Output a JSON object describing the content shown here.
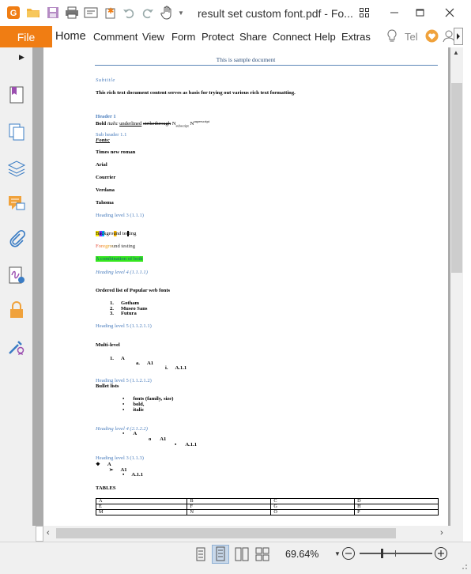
{
  "titlebar": {
    "title": "result set custom font.pdf - Fo...",
    "quick_access": [
      "app-logo-icon",
      "open-folder-icon",
      "save-icon",
      "print-icon",
      "scan-icon",
      "new-icon",
      "undo-icon",
      "redo-icon",
      "hand-tool-icon",
      "dropdown-icon"
    ],
    "window_controls": [
      "grid-icon",
      "minimize-icon",
      "restore-icon",
      "close-icon"
    ]
  },
  "menubar": {
    "file": "File",
    "items": [
      "Home",
      "Comment",
      "View",
      "Form",
      "Protect",
      "Share",
      "Connect",
      "Help",
      "Extras"
    ],
    "tell_me": "Tel",
    "accent_color": "#f07d13"
  },
  "sidebar": {
    "icons": [
      "bookmark-icon",
      "pages-icon",
      "layers-icon",
      "comments-icon",
      "attachments-icon",
      "signature-icon",
      "security-icon",
      "certificate-icon"
    ]
  },
  "document": {
    "header_title": "This is sample document",
    "subtitle": "Subtitle",
    "intro": "This rich text document content serves as basis for trying out various rich text formatting.",
    "header1": "Header 1",
    "fmt_bold": "Bold",
    "fmt_italic": "italic",
    "fmt_underlined": "underlined",
    "fmt_strike": "strikethrough",
    "fmt_n": "N",
    "fmt_sub": "subscript",
    "fmt_n2": "N",
    "fmt_sup": "superscript",
    "subheader": "Sub header 1.1",
    "fonts_label": "Fonts:",
    "fonts": [
      "Times new roman",
      "Arial",
      "Courrier",
      "Verdana",
      "Tahoma"
    ],
    "heading_3a": "Heading level 3 (1.1.1)",
    "background_testing": "Background testing",
    "foreground_testing": "Foreground testing",
    "combination": "A combination of both",
    "heading_4a": "Heading level 4 (1.1.1.1)",
    "ordered_title": "Ordered list of Popular web fonts",
    "ordered_items": [
      {
        "num": "1.",
        "text": "Gotham"
      },
      {
        "num": "2.",
        "text": "Museo Sans"
      },
      {
        "num": "3.",
        "text": "Futura"
      }
    ],
    "heading_5a": "Heading level 5 (1.1.2.1.1)",
    "multilevel_title": "Multi-level",
    "multilevel": [
      {
        "marker": "1.",
        "text": "A"
      },
      {
        "marker": "a.",
        "text": "A1"
      },
      {
        "marker": "i.",
        "text": "A.1.1"
      }
    ],
    "heading_5b": "Heading level 5 (1.1.2.1.2)",
    "bullet_title": "Bullet lists",
    "bullets": [
      "fonts (family, size)",
      "bold,",
      "italic"
    ],
    "heading_4b": "Heading level 4 (2.1.2.2)",
    "nested_bullets": [
      {
        "marker": "•",
        "text": "A"
      },
      {
        "marker": "o",
        "text": "A1"
      },
      {
        "marker": "▪",
        "text": "A.1.1"
      }
    ],
    "heading_3b": "Heading level 3 (1.1.3)",
    "symbol_bullets": [
      {
        "marker": "❖",
        "text": "A"
      },
      {
        "marker": "➢",
        "text": "A1"
      },
      {
        "marker": "▪",
        "text": "A.1.1"
      }
    ],
    "tables_title": "TABLES",
    "table_rows": [
      [
        "A",
        "B",
        "C",
        "D"
      ],
      [
        "E",
        "F",
        "G",
        "H"
      ],
      [
        "M",
        "N",
        "O",
        "P"
      ]
    ],
    "heading_color": "#4a7dbd"
  },
  "statusbar": {
    "view_icons": [
      "single-page-icon",
      "continuous-page-icon",
      "facing-page-icon",
      "continuous-facing-icon"
    ],
    "zoom": "69.64%",
    "zoom_level": 0.3
  }
}
